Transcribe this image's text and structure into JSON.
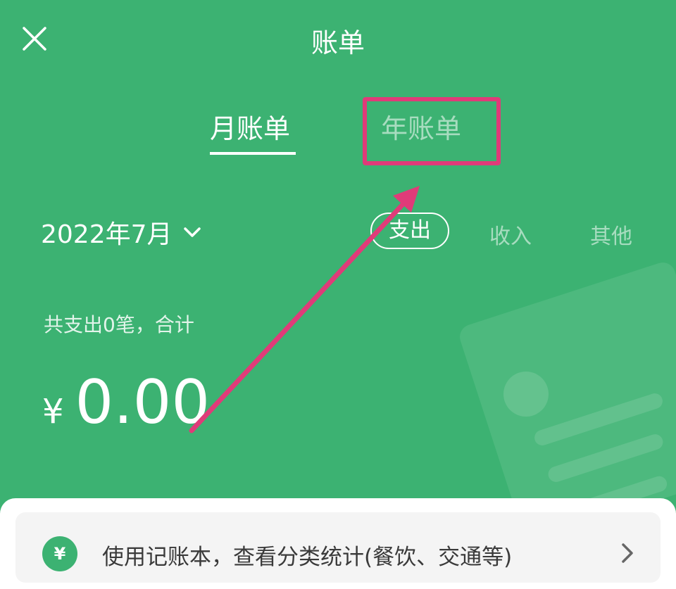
{
  "header": {
    "title": "账单",
    "close_icon": "close-icon"
  },
  "tabs": [
    {
      "label": "月账单",
      "active": true
    },
    {
      "label": "年账单",
      "active": false
    }
  ],
  "date_picker": {
    "value": "2022年7月",
    "icon": "chevron-down-icon"
  },
  "filters": [
    {
      "label": "支出",
      "selected": true
    },
    {
      "label": "收入",
      "selected": false
    },
    {
      "label": "其他",
      "selected": false
    }
  ],
  "summary": {
    "text": "共支出0笔，合计",
    "currency": "¥",
    "amount": "0.00"
  },
  "ledger_banner": {
    "icon_glyph": "¥",
    "text": "使用记账本，查看分类统计(餐饮、交通等)",
    "chevron": "chevron-right-icon"
  },
  "colors": {
    "background": "#3cb272",
    "annotation": "#e03b79",
    "panel": "#ffffff",
    "banner": "#f4f4f4"
  }
}
